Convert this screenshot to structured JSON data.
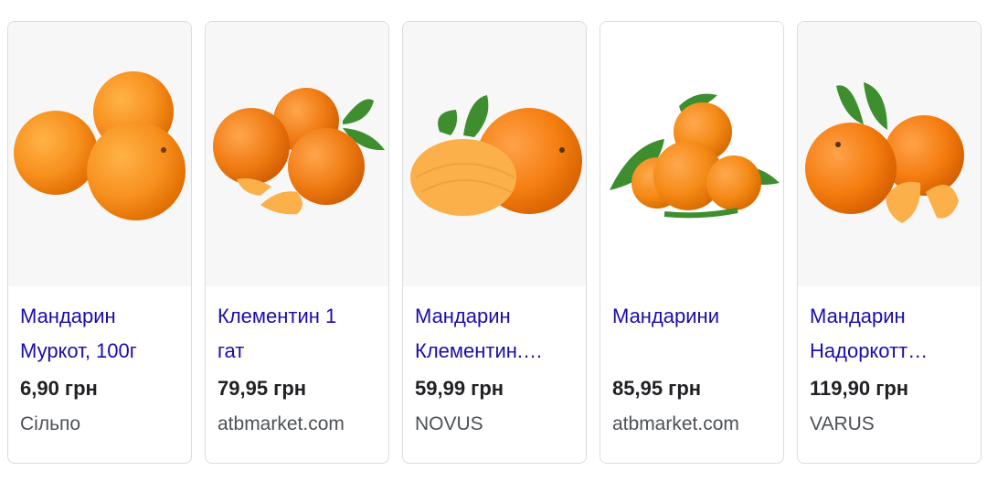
{
  "products": [
    {
      "title_line1": "Мандарин",
      "title_line2": "Муркот, 100г",
      "price": "6,90 грн",
      "store": "Сільпо",
      "image": "three-mandarins-image"
    },
    {
      "title_line1": "Клементин 1",
      "title_line2": "гат",
      "price": "79,95 грн",
      "store": "atbmarket.com",
      "image": "clementines-with-segments-image"
    },
    {
      "title_line1": "Мандарин",
      "title_line2": "Клементин.…",
      "price": "59,99 грн",
      "store": "NOVUS",
      "image": "peeled-and-whole-mandarin-image"
    },
    {
      "title_line1": "Мандарини",
      "title_line2": "",
      "price": "85,95 грн",
      "store": "atbmarket.com",
      "image": "mandarin-pile-with-leaves-image"
    },
    {
      "title_line1": "Мандарин",
      "title_line2": "Надоркотт…",
      "price": "119,90 грн",
      "store": "VARUS",
      "image": "mandarins-with-leaves-and-segments-image"
    }
  ],
  "colors": {
    "title_link": "#1a0dab",
    "price": "#202124",
    "store": "#4d5156",
    "card_border": "#dadce0",
    "thumb_bg": "#f3f3f3",
    "fruit": "#f7901e",
    "leaf": "#3e8e2f"
  }
}
